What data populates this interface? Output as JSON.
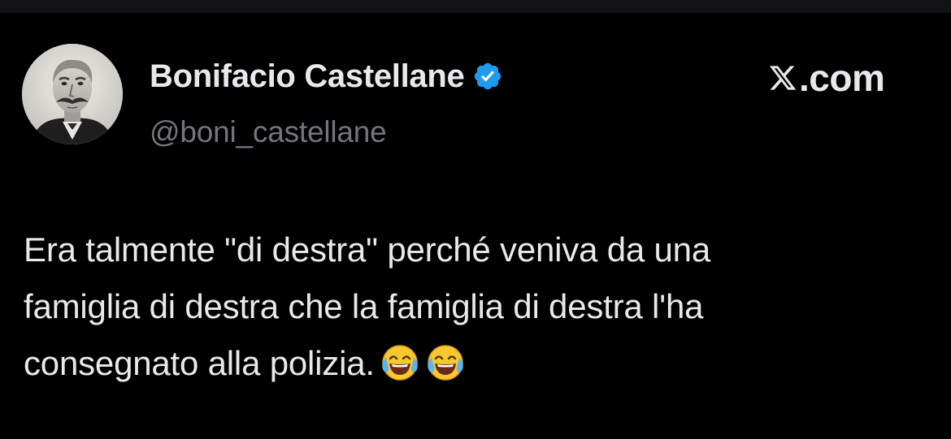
{
  "author": {
    "display_name": "Bonifacio Castellane",
    "handle": "@boni_castellane",
    "verified": true,
    "avatar_icon": "portrait-avatar"
  },
  "brand": {
    "text": ".com",
    "icon": "x-logo-icon"
  },
  "tweet": {
    "lines": [
      "Era talmente \"di destra\" perché veniva da una",
      "famiglia di destra che la famiglia di destra l'ha",
      "consegnato alla polizia."
    ],
    "emojis": [
      "face-with-tears-of-joy-icon",
      "face-with-tears-of-joy-icon"
    ]
  },
  "colors": {
    "background": "#000000",
    "text_primary": "#e7e9ea",
    "text_secondary": "#71767b",
    "verified_badge": "#1d9bf0"
  }
}
